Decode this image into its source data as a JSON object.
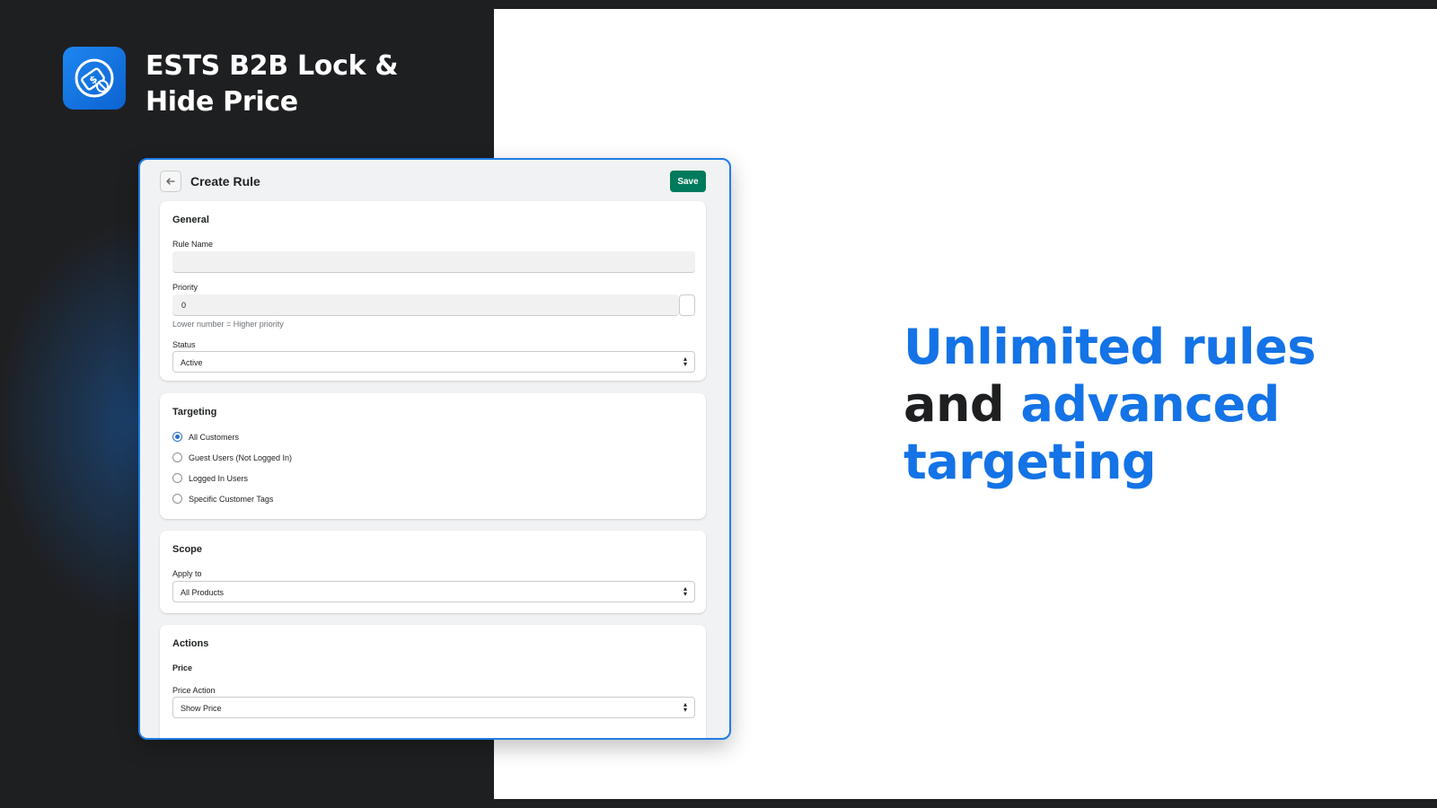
{
  "brand": {
    "title": "ESTS B2B Lock & Hide Price",
    "logo_icon": "price-tag-hidden-icon",
    "accent": "#1473e6"
  },
  "headline": {
    "part1": "Unlimited rules",
    "part2": "and",
    "part3": "advanced",
    "part4": "targeting"
  },
  "app": {
    "page_title": "Create Rule",
    "back_icon": "arrow-left-icon",
    "save_label": "Save",
    "save_color": "#007a5c"
  },
  "general": {
    "title": "General",
    "rule_name_label": "Rule Name",
    "rule_name_value": "",
    "priority_label": "Priority",
    "priority_value": "0",
    "priority_help": "Lower number = Higher priority",
    "status_label": "Status",
    "status_value": "Active"
  },
  "targeting": {
    "title": "Targeting",
    "options": [
      {
        "label": "All Customers",
        "checked": true
      },
      {
        "label": "Guest Users (Not Logged In)",
        "checked": false
      },
      {
        "label": "Logged In Users",
        "checked": false
      },
      {
        "label": "Specific Customer Tags",
        "checked": false
      }
    ]
  },
  "scope": {
    "title": "Scope",
    "apply_label": "Apply to",
    "apply_value": "All Products"
  },
  "actions": {
    "title": "Actions",
    "price_subtitle": "Price",
    "price_action_label": "Price Action",
    "price_action_value": "Show Price"
  }
}
